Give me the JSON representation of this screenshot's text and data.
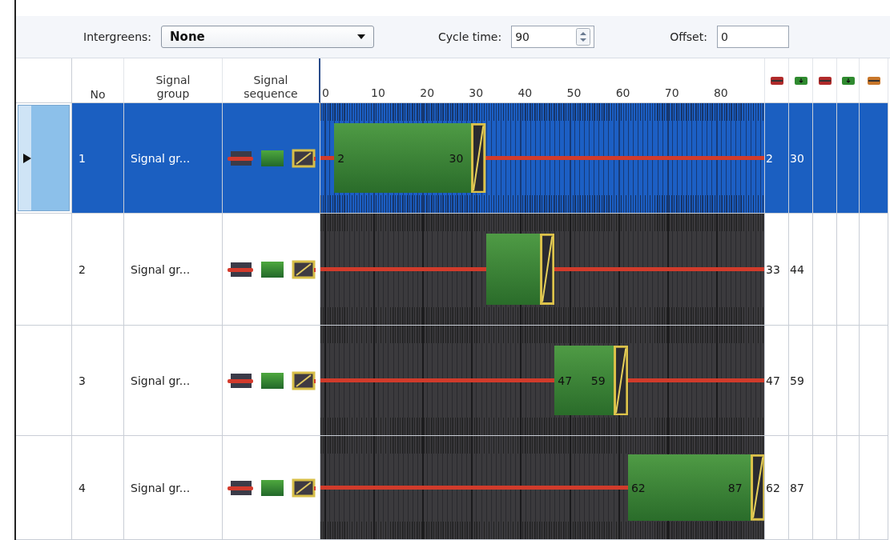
{
  "toolbar": {
    "intergreens_label": "Intergreens:",
    "intergreens_value": "None",
    "cycle_time_label": "Cycle time:",
    "cycle_time_value": "90",
    "offset_label": "Offset:",
    "offset_value": "0"
  },
  "columns": {
    "no": "No",
    "signal_group": "Signal group",
    "signal_sequence": "Signal sequence",
    "ticks": [
      "0",
      "10",
      "20",
      "30",
      "40",
      "50",
      "60",
      "70",
      "80"
    ]
  },
  "rows": [
    {
      "no": "1",
      "name": "Signal gr...",
      "selected": true,
      "bar_start": "2",
      "bar_end": "30",
      "start": "2",
      "end": "30"
    },
    {
      "no": "2",
      "name": "Signal gr...",
      "selected": false,
      "start": "33",
      "end": "44"
    },
    {
      "no": "3",
      "name": "Signal gr...",
      "selected": false,
      "bar_start": "47",
      "bar_end": "59",
      "start": "47",
      "end": "59"
    },
    {
      "no": "4",
      "name": "Signal gr...",
      "selected": false,
      "bar_start": "62",
      "bar_end": "87",
      "start": "62",
      "end": "87"
    }
  ]
}
